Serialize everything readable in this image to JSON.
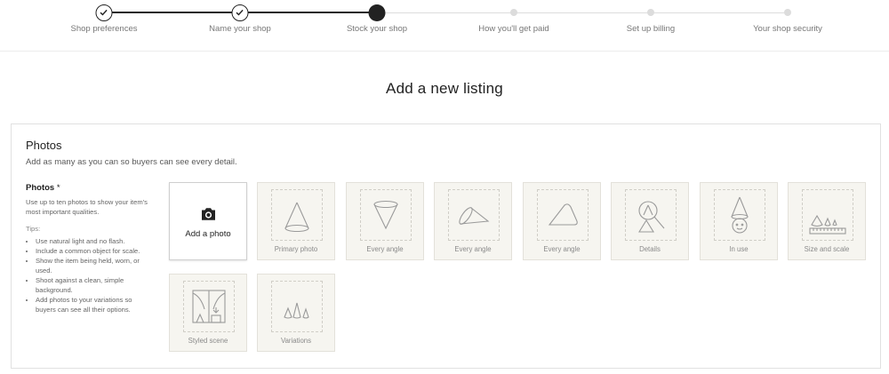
{
  "stepper": {
    "steps": [
      {
        "label": "Shop preferences",
        "state": "done"
      },
      {
        "label": "Name your shop",
        "state": "done"
      },
      {
        "label": "Stock your shop",
        "state": "current"
      },
      {
        "label": "How you'll get paid",
        "state": "todo"
      },
      {
        "label": "Set up billing",
        "state": "todo"
      },
      {
        "label": "Your shop security",
        "state": "todo"
      }
    ]
  },
  "page": {
    "title": "Add a new listing"
  },
  "photos": {
    "title": "Photos",
    "subtitle": "Add as many as you can so buyers can see every detail.",
    "field_label": "Photos",
    "required_mark": "*",
    "description": "Use up to ten photos to show your item's most important qualities.",
    "tips_label": "Tips:",
    "tips": [
      "Use natural light and no flash.",
      "Include a common object for scale.",
      "Show the item being held, worn, or used.",
      "Shoot against a clean, simple background.",
      "Add photos to your variations so buyers can see all their options."
    ],
    "add_label": "Add a photo",
    "slots": [
      {
        "caption": "Primary photo",
        "icon": "cone-icon"
      },
      {
        "caption": "Every angle",
        "icon": "cone-inverted-icon"
      },
      {
        "caption": "Every angle",
        "icon": "cone-side-icon"
      },
      {
        "caption": "Every angle",
        "icon": "cone-tilted-icon"
      },
      {
        "caption": "Details",
        "icon": "magnifier-cone-icon"
      },
      {
        "caption": "In use",
        "icon": "cone-on-face-icon"
      },
      {
        "caption": "Size and scale",
        "icon": "cones-ruler-icon"
      },
      {
        "caption": "Styled scene",
        "icon": "window-scene-icon"
      },
      {
        "caption": "Variations",
        "icon": "three-cones-icon"
      }
    ]
  }
}
